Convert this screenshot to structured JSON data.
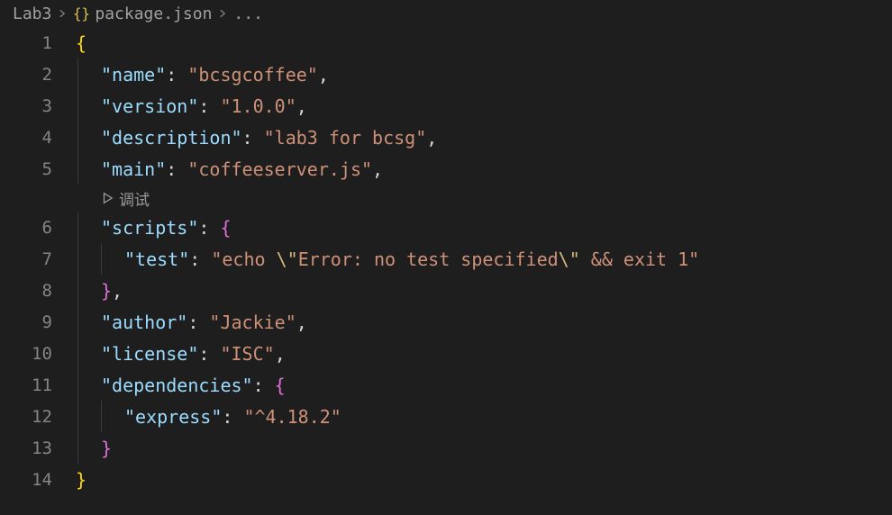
{
  "breadcrumbs": {
    "folder": "Lab3",
    "file": "package.json",
    "ellipsis": "..."
  },
  "codelens": {
    "label": "调试"
  },
  "lines": {
    "l1": "1",
    "l2": "2",
    "l3": "3",
    "l4": "4",
    "l5": "5",
    "l6": "6",
    "l7": "7",
    "l8": "8",
    "l9": "9",
    "l10": "10",
    "l11": "11",
    "l12": "12",
    "l13": "13",
    "l14": "14"
  },
  "json": {
    "name_key": "\"name\"",
    "name_val": "\"bcsgcoffee\"",
    "version_key": "\"version\"",
    "version_val": "\"1.0.0\"",
    "description_key": "\"description\"",
    "description_val": "\"lab3 for bcsg\"",
    "main_key": "\"main\"",
    "main_val": "\"coffeeserver.js\"",
    "scripts_key": "\"scripts\"",
    "test_key": "\"test\"",
    "test_val_a": "\"echo ",
    "test_val_esc1": "\\\"",
    "test_val_b": "Error: no test specified",
    "test_val_esc2": "\\\"",
    "test_val_c": " && exit 1\"",
    "author_key": "\"author\"",
    "author_val": "\"Jackie\"",
    "license_key": "\"license\"",
    "license_val": "\"ISC\"",
    "dependencies_key": "\"dependencies\"",
    "express_key": "\"express\"",
    "express_val": "\"^4.18.2\""
  },
  "punct": {
    "open_brace": "{",
    "close_brace": "}",
    "colon_sp": ": ",
    "comma": ",",
    "close_brace_comma": "},"
  }
}
